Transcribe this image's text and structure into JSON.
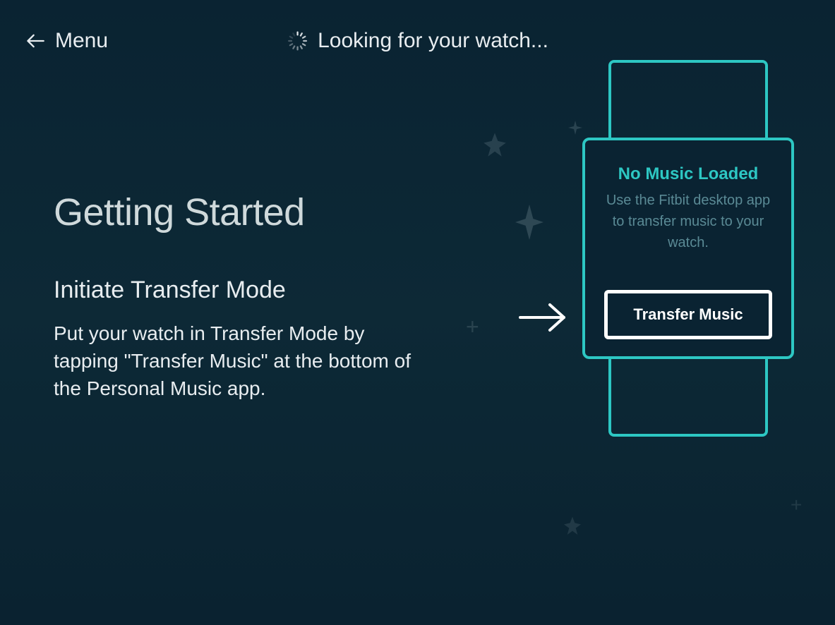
{
  "header": {
    "menu_label": "Menu",
    "status_text": "Looking for your watch..."
  },
  "main": {
    "title": "Getting Started",
    "subtitle": "Initiate Transfer Mode",
    "description": "Put your watch in Transfer Mode by tapping \"Transfer Music\" at the bottom of the Personal Music app."
  },
  "watch": {
    "screen_title": "No Music Loaded",
    "screen_desc": "Use the Fitbit desktop app to transfer music to your watch.",
    "button_label": "Transfer Music"
  }
}
